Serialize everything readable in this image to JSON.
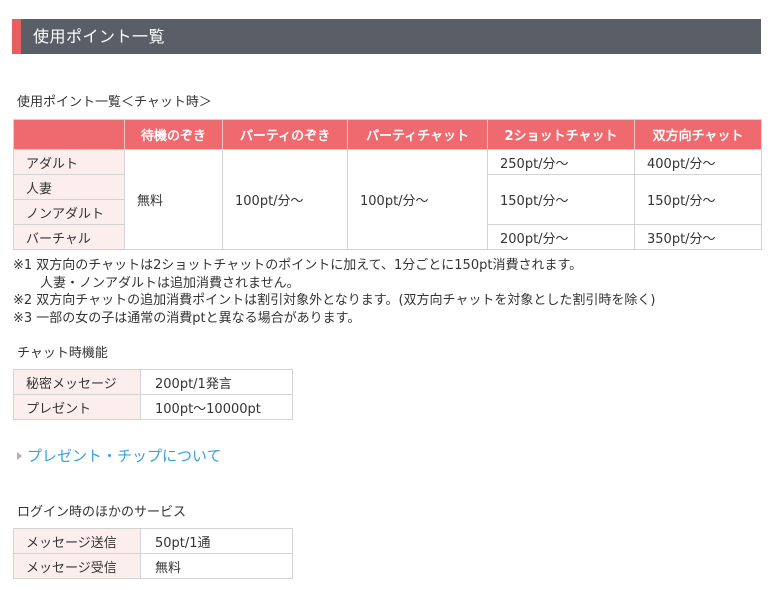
{
  "header": {
    "title": "使用ポイント一覧"
  },
  "usage_table": {
    "caption": "使用ポイント一覧＜チャット時＞",
    "columns": [
      "待機のぞき",
      "パーティのぞき",
      "パーティチャット",
      "2ショットチャット",
      "双方向チャット"
    ],
    "rows": [
      "アダルト",
      "人妻",
      "ノンアダルト",
      "バーチャル"
    ],
    "waiting_peek": "無料",
    "party_peek": "100pt/分～",
    "party_chat": "100pt/分～",
    "two_shot": {
      "adult": "250pt/分～",
      "wife_nonadult": "150pt/分～",
      "virtual": "200pt/分～"
    },
    "two_way": {
      "adult": "400pt/分～",
      "wife_nonadult": "150pt/分～",
      "virtual": "350pt/分～"
    }
  },
  "notes": [
    "※1 双方向のチャットは2ショットチャットのポイントに加えて、1分ごとに150pt消費されます。",
    "人妻・ノンアダルトは追加消費されません。",
    "※2 双方向チャットの追加消費ポイントは割引対象外となります。(双方向チャットを対象とした割引時を除く)",
    "※3 一部の女の子は通常の消費ptと異なる場合があります。"
  ],
  "chat_features": {
    "caption": "チャット時機能",
    "rows": [
      {
        "label": "秘密メッセージ",
        "value": "200pt/1発言"
      },
      {
        "label": "プレゼント",
        "value": "100pt～10000pt"
      }
    ]
  },
  "present_link": {
    "label": "プレゼント・チップについて"
  },
  "login_services": {
    "caption": "ログイン時のほかのサービス",
    "rows": [
      {
        "label": "メッセージ送信",
        "value": "50pt/1通"
      },
      {
        "label": "メッセージ受信",
        "value": "無料"
      }
    ]
  },
  "colors": {
    "header_bg": "#5a5e66",
    "accent": "#e85d5d",
    "table_header": "#ef6a6e",
    "row_header_bg": "#fdeeee",
    "link": "#3aa0d8"
  }
}
